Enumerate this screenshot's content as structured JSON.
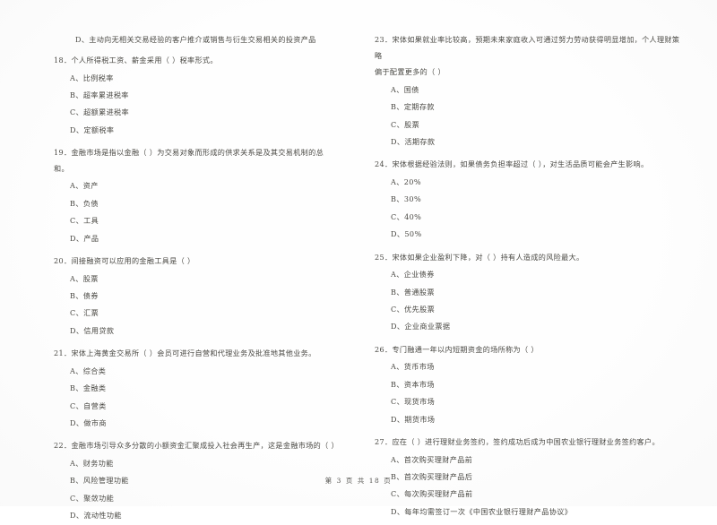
{
  "document": {
    "type": "scanned-exam-paper",
    "footer": "第 3 页 共 18 页"
  },
  "left_column": {
    "orphan_option": "D、主动向无相关交易经验的客户推介或销售与衍生交易相关的投资产品",
    "questions": [
      {
        "stem": "18．个人所得税工资、薪金采用（      ）税率形式。",
        "options": [
          "A、比例税率",
          "B、超率累进税率",
          "C、超额累进税率",
          "D、定额税率"
        ]
      },
      {
        "stem": "19．金融市场是指以金融（      ）为交易对象而形成的供求关系是及其交易机制的总和。",
        "options": [
          "A、资产",
          "B、负债",
          "C、工具",
          "D、产品"
        ]
      },
      {
        "stem": "20．间接融资可以应用的金融工具是（      ）",
        "options": [
          "A、股票",
          "B、债券",
          "C、汇票",
          "D、信用贷款"
        ]
      },
      {
        "stem": "21．宋体上海黄金交易所（      ）会员可进行自营和代理业务及批准地其他业务。",
        "options": [
          "A、综合类",
          "B、金融类",
          "C、自营类",
          "D、做市商"
        ]
      },
      {
        "stem": "22．金融市场引导众多分散的小额资金汇聚成投入社会再生产，这是金融市场的（      ）",
        "options": [
          "A、财务功能",
          "B、风险管理功能",
          "C、聚敛功能",
          "D、流动性功能"
        ]
      }
    ]
  },
  "right_column": {
    "questions": [
      {
        "stem": "23．宋体如果就业率比较高，预期未来家庭收入可通过努力劳动获得明显增加，个人理财策略",
        "stem_cont": "偏于配置更多的（      ）",
        "options": [
          "A、国债",
          "B、定期存款",
          "C、股票",
          "D、活期存款"
        ]
      },
      {
        "stem": "24．宋体根据经验法则，如果债务负担率超过（       ），对生活品质可能会产生影响。",
        "options": [
          "A、20%",
          "B、30%",
          "C、40%",
          "D、50%"
        ]
      },
      {
        "stem": "25．宋体如果企业盈利下降，对（      ）持有人造成的风险最大。",
        "options": [
          "A、企业债券",
          "B、普通股票",
          "C、优先股票",
          "D、企业商业票据"
        ]
      },
      {
        "stem": "26．专门融通一年以内短期资金的场所称为（      ）",
        "options": [
          "A、货币市场",
          "B、资本市场",
          "C、现货市场",
          "D、期货市场"
        ]
      },
      {
        "stem": "27．应在（      ）进行理财业务签约，签约成功后成为中国农业银行理财业务签约客户。",
        "options": [
          "A、首次购买理财产品前",
          "B、首次购买理财产品后",
          "C、每次购买理财产品前",
          "D、每年均需签订一次《中国农业银行理财产品协议》"
        ]
      }
    ]
  }
}
